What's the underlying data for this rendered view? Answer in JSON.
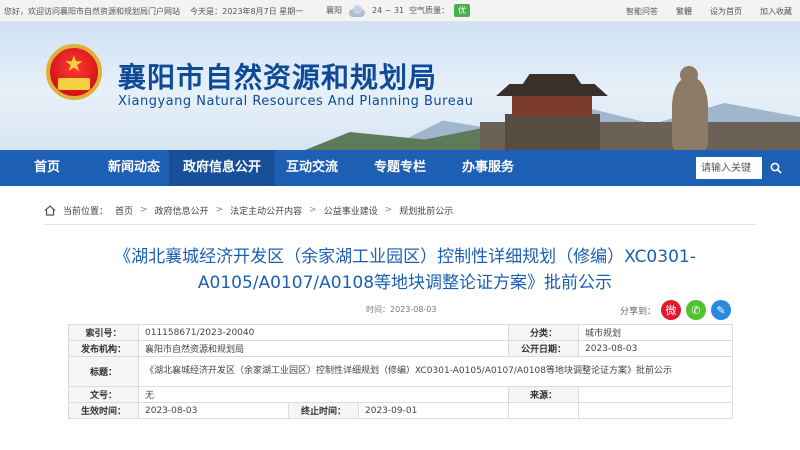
{
  "topbar": {
    "welcome": "您好，欢迎访问襄阳市自然资源和规划局门户网站",
    "date": "今天是：2023年8月7日 星期一",
    "city": "襄阳",
    "temp": "24 ~ 31",
    "aq_label": "空气质量：",
    "aq_value": "优",
    "links": [
      "智能问答",
      "繁體",
      "设为首页",
      "加入收藏"
    ]
  },
  "banner": {
    "title": "襄阳市自然资源和规划局",
    "subtitle": "Xiangyang Natural Resources And Planning Bureau"
  },
  "nav": {
    "items": [
      "首页",
      "新闻动态",
      "政府信息公开",
      "互动交流",
      "专题专栏",
      "办事服务"
    ],
    "search_placeholder": "请输入关键"
  },
  "breadcrumb": {
    "label": "当前位置：",
    "items": [
      "首页",
      "政府信息公开",
      "法定主动公开内容",
      "公益事业建设",
      "规划批前公示"
    ]
  },
  "article": {
    "title": "《湖北襄城经济开发区（余家湖工业园区）控制性详细规划（修编）XC0301-A0105/A0107/A0108等地块调整论证方案》批前公示",
    "time": "时间：2023-08-03",
    "share_label": "分享到："
  },
  "meta": {
    "index_label": "索引号：",
    "index_value": "011158671/2023-20040",
    "category_label": "分类：",
    "category_value": "城市规划",
    "publisher_label": "发布机构：",
    "publisher_value": "襄阳市自然资源和规划局",
    "pubdate_label": "公开日期：",
    "pubdate_value": "2023-08-03",
    "title_label": "标题：",
    "title_value": "《湖北襄城经济开发区（余家湖工业园区）控制性详细规划（修编）XC0301-A0105/A0107/A0108等地块调整论证方案》批前公示",
    "docno_label": "文号：",
    "docno_value": "无",
    "source_label": "来源：",
    "source_value": "",
    "effective_label": "生效时间：",
    "effective_value": "2023-08-03",
    "end_label": "终止时间：",
    "end_value": "2023-09-01"
  }
}
